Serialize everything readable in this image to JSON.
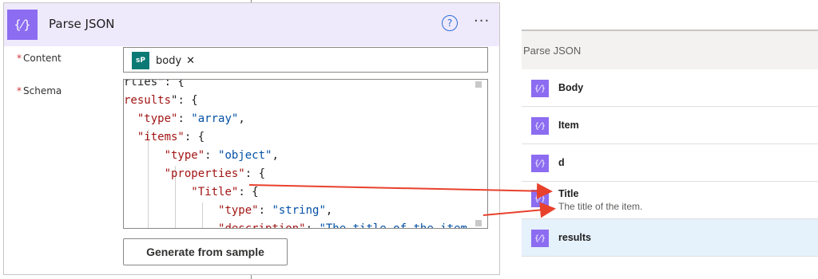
{
  "card": {
    "title": "Parse JSON",
    "icon": "braces-icon",
    "help_glyph": "?",
    "more_glyph": "···",
    "content_label": "Content",
    "schema_label": "Schema",
    "required_mark": "*",
    "token": {
      "text": "body",
      "icon_text": "s",
      "remove_glyph": "✕"
    },
    "code_lines": [
      {
        "parts": [
          {
            "t": "rties\": {",
            "c": ""
          }
        ]
      },
      {
        "parts": [
          {
            "t": "results",
            "c": "k"
          },
          {
            "t": "\": {",
            "c": ""
          }
        ]
      },
      {
        "parts": [
          {
            "t": "  ",
            "c": ""
          },
          {
            "t": "\"type\"",
            "c": "k"
          },
          {
            "t": ": ",
            "c": ""
          },
          {
            "t": "\"array\"",
            "c": "s"
          },
          {
            "t": ",",
            "c": ""
          }
        ]
      },
      {
        "parts": [
          {
            "t": "  ",
            "c": ""
          },
          {
            "t": "\"items\"",
            "c": "k"
          },
          {
            "t": ": {",
            "c": ""
          }
        ]
      },
      {
        "parts": [
          {
            "t": "      ",
            "c": ""
          },
          {
            "t": "\"type\"",
            "c": "k"
          },
          {
            "t": ": ",
            "c": ""
          },
          {
            "t": "\"object\"",
            "c": "s"
          },
          {
            "t": ",",
            "c": ""
          }
        ]
      },
      {
        "parts": [
          {
            "t": "      ",
            "c": ""
          },
          {
            "t": "\"properties\"",
            "c": "k"
          },
          {
            "t": ": {",
            "c": ""
          }
        ]
      },
      {
        "parts": [
          {
            "t": "          ",
            "c": ""
          },
          {
            "t": "\"Title\"",
            "c": "k"
          },
          {
            "t": ": {",
            "c": ""
          }
        ]
      },
      {
        "parts": [
          {
            "t": "              ",
            "c": ""
          },
          {
            "t": "\"type\"",
            "c": "k"
          },
          {
            "t": ": ",
            "c": ""
          },
          {
            "t": "\"string\"",
            "c": "s"
          },
          {
            "t": ",",
            "c": ""
          }
        ]
      },
      {
        "parts": [
          {
            "t": "              ",
            "c": ""
          },
          {
            "t": "\"description\"",
            "c": "k"
          },
          {
            "t": ": ",
            "c": ""
          },
          {
            "t": "\"The title of the item.\"",
            "c": "s"
          }
        ]
      },
      {
        "parts": [
          {
            "t": "          }",
            "c": ""
          }
        ]
      }
    ],
    "generate_label": "Generate from sample"
  },
  "panel": {
    "title": "Parse JSON",
    "items": [
      {
        "label": "Body",
        "desc": "",
        "selected": false
      },
      {
        "label": "Item",
        "desc": "",
        "selected": false
      },
      {
        "label": "d",
        "desc": "",
        "selected": false
      },
      {
        "label": "Title",
        "desc": "The title of the item.",
        "selected": false
      },
      {
        "label": "results",
        "desc": "",
        "selected": true
      }
    ]
  },
  "colors": {
    "accent": "#8c6cf0",
    "header_bg": "#efe9fc",
    "arrow": "#e8412c",
    "sharepoint": "#0b7a75"
  }
}
